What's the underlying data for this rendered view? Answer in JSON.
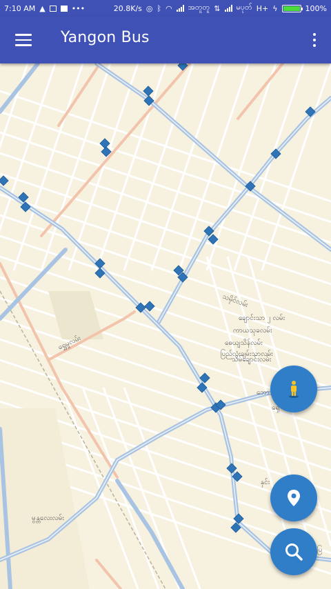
{
  "status_bar": {
    "time": "7:10 AM",
    "net_speed": "20.8K/s",
    "carrier1": "အတူတူ",
    "carrier2": "မပုတ်",
    "network_type": "H+",
    "battery_text": "100%",
    "battery_level": 1.0
  },
  "appbar": {
    "title": "Yangon Bus",
    "menu_icon": "hamburger-menu-icon",
    "overflow_icon": "more-vert-icon"
  },
  "map": {
    "street_labels": [
      "သမိုင်လမ်း",
      "ချောင်းသာ ၂ လမ်း",
      "ကာယသုခလမ်း",
      "ဓေယျသိန်လမ်း",
      "ပြည်လုံးချမ်းသာလမ်း",
      "သိမ်ချောင်းလမ်း",
      "ရွှေမှုလမ်း",
      "မွန္တလေးလမ်း",
      "ဘော",
      "ရှေ",
      "နှင်း",
      "ပြ"
    ],
    "colors": {
      "background": "#f7f1df",
      "main_road": "#a9c3e3",
      "secondary_road": "#f2c4ac",
      "bus_stop": "#2f74b7"
    }
  },
  "fabs": {
    "street_view": "pegman-icon",
    "my_location": "location-pin-icon",
    "search": "search-icon",
    "color": "#2f7ec7"
  }
}
